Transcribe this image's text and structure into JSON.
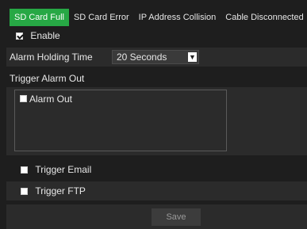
{
  "tabs": [
    {
      "label": "SD Card Full",
      "active": true
    },
    {
      "label": "SD Card Error",
      "active": false
    },
    {
      "label": "IP Address Collision",
      "active": false
    },
    {
      "label": "Cable Disconnected",
      "active": false
    }
  ],
  "enable": {
    "label": "Enable",
    "checked": true
  },
  "alarm_holding_time": {
    "label": "Alarm Holding Time",
    "value": "20 Seconds"
  },
  "trigger_alarm_out": {
    "label": "Trigger Alarm Out",
    "items": [
      {
        "label": "Alarm Out",
        "checked": false
      }
    ]
  },
  "trigger_email": {
    "label": "Trigger Email",
    "checked": false
  },
  "trigger_ftp": {
    "label": "Trigger FTP",
    "checked": false
  },
  "save_label": "Save",
  "colors": {
    "accent": "#27a845",
    "background": "#1e1e1e",
    "row_alt": "#2b2b2b"
  }
}
